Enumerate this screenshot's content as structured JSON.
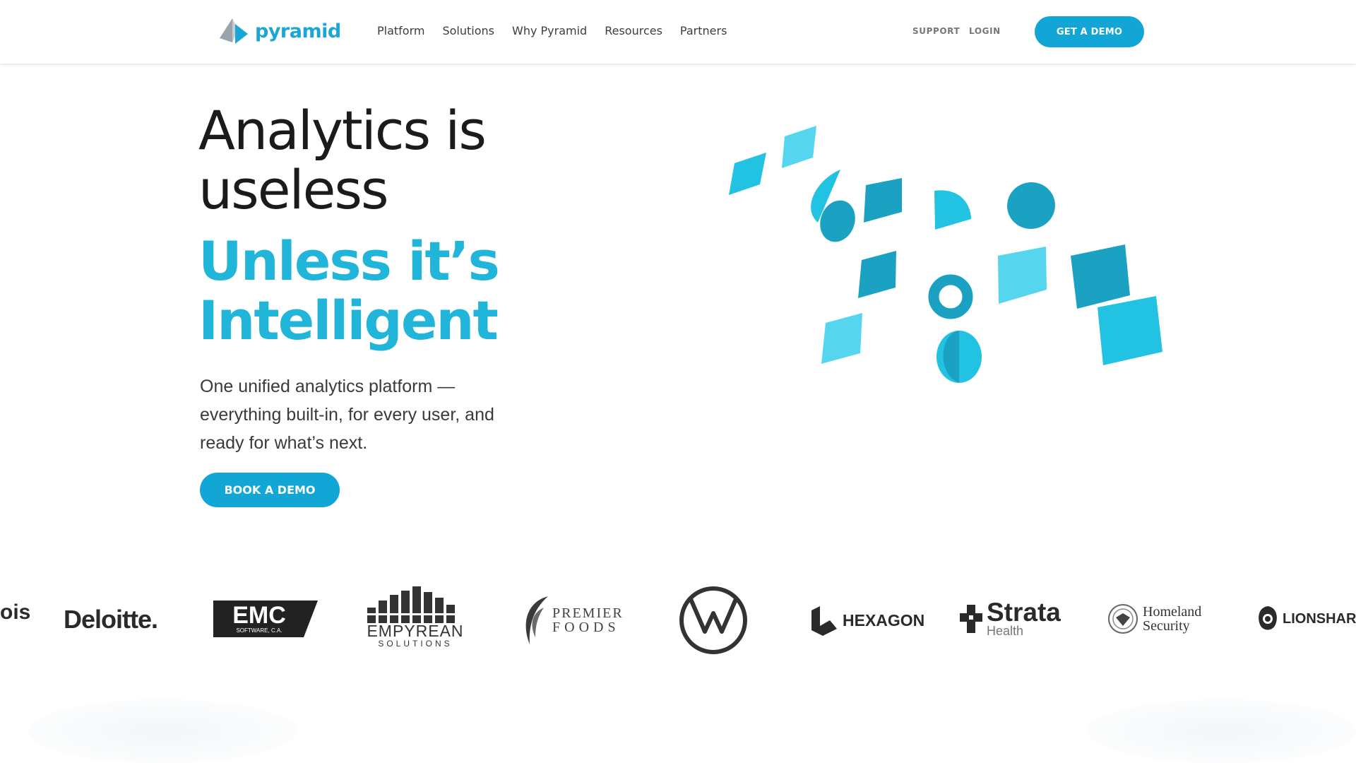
{
  "header": {
    "logo_text": "pyramid",
    "nav": [
      "Platform",
      "Solutions",
      "Why Pyramid",
      "Resources",
      "Partners"
    ],
    "support_label": "SUPPORT",
    "login_label": "LOGIN",
    "cta_label": "GET A DEMO"
  },
  "hero": {
    "headline_lines": [
      "Analytics is",
      "useless"
    ],
    "accent_lines": [
      "Unless it’s",
      "Intelligent"
    ],
    "lede": "One unified analytics platform — everything built-in, for every user, and ready for what’s next.",
    "cta_label": "BOOK A DEMO"
  },
  "logos": {
    "partial_left": "ois",
    "deloitte": "Deloitte.",
    "emc_main": "EMC",
    "emc_sub": "SOFTWARE, C.A.",
    "empyrean_main": "EMPYREAN",
    "empyrean_sub": "SOLUTIONS",
    "premier_top": "PREMIER",
    "premier_bottom": "FOODS",
    "hexagon": "HEXAGON",
    "strata_main": "Strata",
    "strata_sub": "Health",
    "homeland_top": "Homeland",
    "homeland_bottom": "Security",
    "lionshare": "LIONSHARE"
  },
  "colors": {
    "brand": "#12a6d7",
    "accent_text": "#21b5d9",
    "shape_light": "#56d6ee",
    "shape_mid": "#22c3e2",
    "shape_dark": "#1ba2c2"
  }
}
